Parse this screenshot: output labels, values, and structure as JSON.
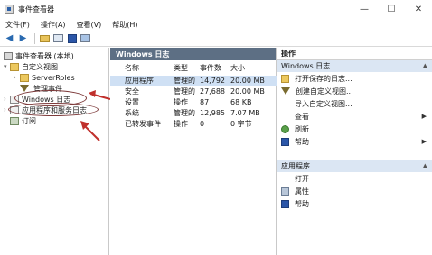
{
  "window": {
    "title": "事件查看器",
    "minimize": "—",
    "maximize": "☐",
    "close": "✕"
  },
  "menu": [
    "文件(F)",
    "操作(A)",
    "查看(V)",
    "帮助(H)"
  ],
  "toolbar": {
    "back": "◀",
    "forward": "▶"
  },
  "tree": {
    "root": "事件查看器 (本地)",
    "custom_views": "自定义视图",
    "server_roles": "ServerRoles",
    "admin_events": "管理事件",
    "windows_logs": "Windows 日志",
    "app_service_logs": "应用程序和服务日志",
    "subscriptions": "订阅"
  },
  "middle": {
    "header": "Windows 日志",
    "columns": [
      "名称",
      "类型",
      "事件数",
      "大小"
    ],
    "rows": [
      {
        "name": "应用程序",
        "type": "管理的",
        "count": "14,792",
        "size": "20.00 MB"
      },
      {
        "name": "安全",
        "type": "管理的",
        "count": "27,688",
        "size": "20.00 MB"
      },
      {
        "name": "设置",
        "type": "操作",
        "count": "87",
        "size": "68 KB"
      },
      {
        "name": "系统",
        "type": "管理的",
        "count": "12,985",
        "size": "7.07 MB"
      },
      {
        "name": "已转发事件",
        "type": "操作",
        "count": "0",
        "size": "0 字节"
      }
    ]
  },
  "actions": {
    "header": "操作",
    "section1": "Windows 日志",
    "items1": [
      "打开保存的日志...",
      "创建自定义视图...",
      "导入自定义视图...",
      "查看",
      "刷新",
      "帮助"
    ],
    "section2": "应用程序",
    "items2": [
      "打开",
      "属性",
      "帮助"
    ]
  },
  "colors": {
    "header_bg": "#5d6f84",
    "selection": "#cfe0f4",
    "section_bg": "#dbe6f3",
    "annotation": "#c0302c"
  }
}
